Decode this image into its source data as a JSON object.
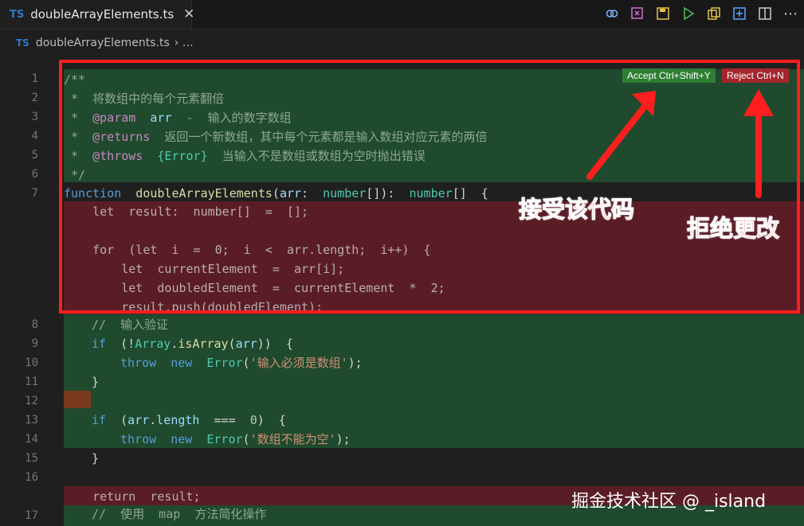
{
  "tab": {
    "lang": "TS",
    "file": "doubleArrayElements.ts",
    "close": "✕"
  },
  "toolbar": {
    "icons": [
      "link-icon",
      "close-all-icon",
      "save-icon",
      "run-icon",
      "copy-icon",
      "add-icon",
      "split-icon",
      "more-icon"
    ],
    "more": "⋯"
  },
  "breadcrumb": {
    "lang": "TS",
    "file": "doubleArrayElements.ts",
    "sep": "› …"
  },
  "diff": {
    "accept": "Accept Ctrl+Shift+Y",
    "reject": "Reject Ctrl+N"
  },
  "annotations": {
    "accept": "接受该代码",
    "reject": "拒绝更改"
  },
  "watermark": "掘金技术社区 @ _island",
  "line_numbers": [
    "1",
    "2",
    "3",
    "4",
    "5",
    "6",
    "7",
    "8",
    "9",
    "10",
    "11",
    "12",
    "13",
    "14",
    "15",
    "16",
    "17"
  ],
  "code": {
    "l0": "/**",
    "l1": " *  将数组中的每个元素翻倍",
    "l2a": " *  ",
    "l2b": "@param",
    "l2c": "  arr",
    "l2d": "  -  输入的数字数组",
    "l3a": " *  ",
    "l3b": "@returns",
    "l3c": "  返回一个新数组，其中每个元素都是输入数组对应元素的两倍",
    "l4a": " *  ",
    "l4b": "@throws",
    "l4c": "  {Error}",
    "l4d": "  当输入不是数组或数组为空时抛出错误",
    "l5": " */",
    "l6a": "function",
    "l6b": "  doubleArrayElements",
    "l6c": "(",
    "l6d": "arr",
    "l6e": ":  ",
    "l6f": "number",
    "l6g": "[]):  ",
    "l6h": "number",
    "l6i": "[]  {",
    "r1": "    let  result:  number[]  =  [];",
    "r2": "",
    "r3": "    for  (let  i  =  0;  i  <  arr.length;  i++)  {",
    "r4": "        let  currentElement  =  arr[i];",
    "r5": "        let  doubledElement  =  currentElement  *  2;",
    "r6": "        result.push(doubledElement);",
    "l8": "//  输入验证",
    "l9a": "if",
    "l9b": "  (!",
    "l9c": "Array",
    "l9d": ".",
    "l9e": "isArray",
    "l9f": "(",
    "l9g": "arr",
    "l9h": "))  {",
    "l10a": "throw",
    "l10b": "  new",
    "l10c": "  Error",
    "l10d": "(",
    "l10e": "'输入必须是数组'",
    "l10f": ");",
    "l11": "}",
    "l13a": "if",
    "l13b": "  (",
    "l13c": "arr",
    "l13d": ".",
    "l13e": "length",
    "l13f": "  ===  ",
    "l13g": "0",
    "l13h": ")  {",
    "l14a": "throw",
    "l14b": "  new",
    "l14c": "  Error",
    "l14d": "(",
    "l14e": "'数组不能为空'",
    "l14f": ");",
    "l15": "}",
    "ret": "    return  result;",
    "l17": "//  使用  map  方法简化操作"
  }
}
